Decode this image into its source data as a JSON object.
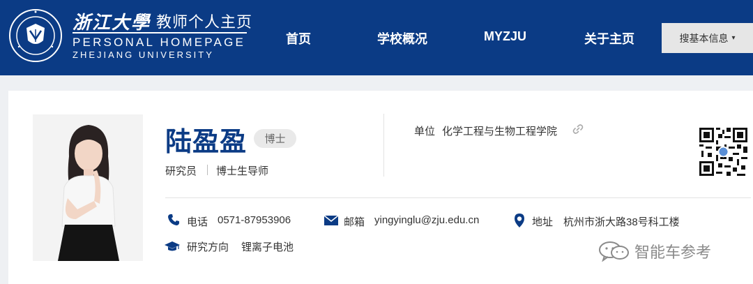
{
  "header": {
    "logo_cn": "浙江大學",
    "logo_subtitle": "教师个人主页",
    "logo_en_line1": "PERSONAL HOMEPAGE",
    "logo_en_line2": "ZHEJIANG UNIVERSITY",
    "seal_icon": "zju-seal-logo",
    "nav": [
      "首页",
      "学校概况",
      "MYZJU",
      "关于主页"
    ],
    "search_label": "搜基本信息",
    "search_caret": "▾"
  },
  "profile": {
    "name": "陆盈盈",
    "degree": "博士",
    "title1": "研究员",
    "title2": "博士生导师",
    "unit_label": "单位",
    "unit_value": "化学工程与生物工程学院",
    "contacts": {
      "phone_label": "电话",
      "phone_value": "0571-87953906",
      "email_label": "邮箱",
      "email_value": "yingyinglu@zju.edu.cn",
      "address_label": "地址",
      "address_value": "杭州市浙大路38号科工楼",
      "research_label": "研究方向",
      "research_value": "锂离子电池"
    }
  },
  "watermark": "智能车参考",
  "colors": {
    "header_bg": "#0b3b85",
    "name_color": "#0b3b85",
    "page_bg": "#eef0f3",
    "icon_color": "#0b3b85"
  }
}
